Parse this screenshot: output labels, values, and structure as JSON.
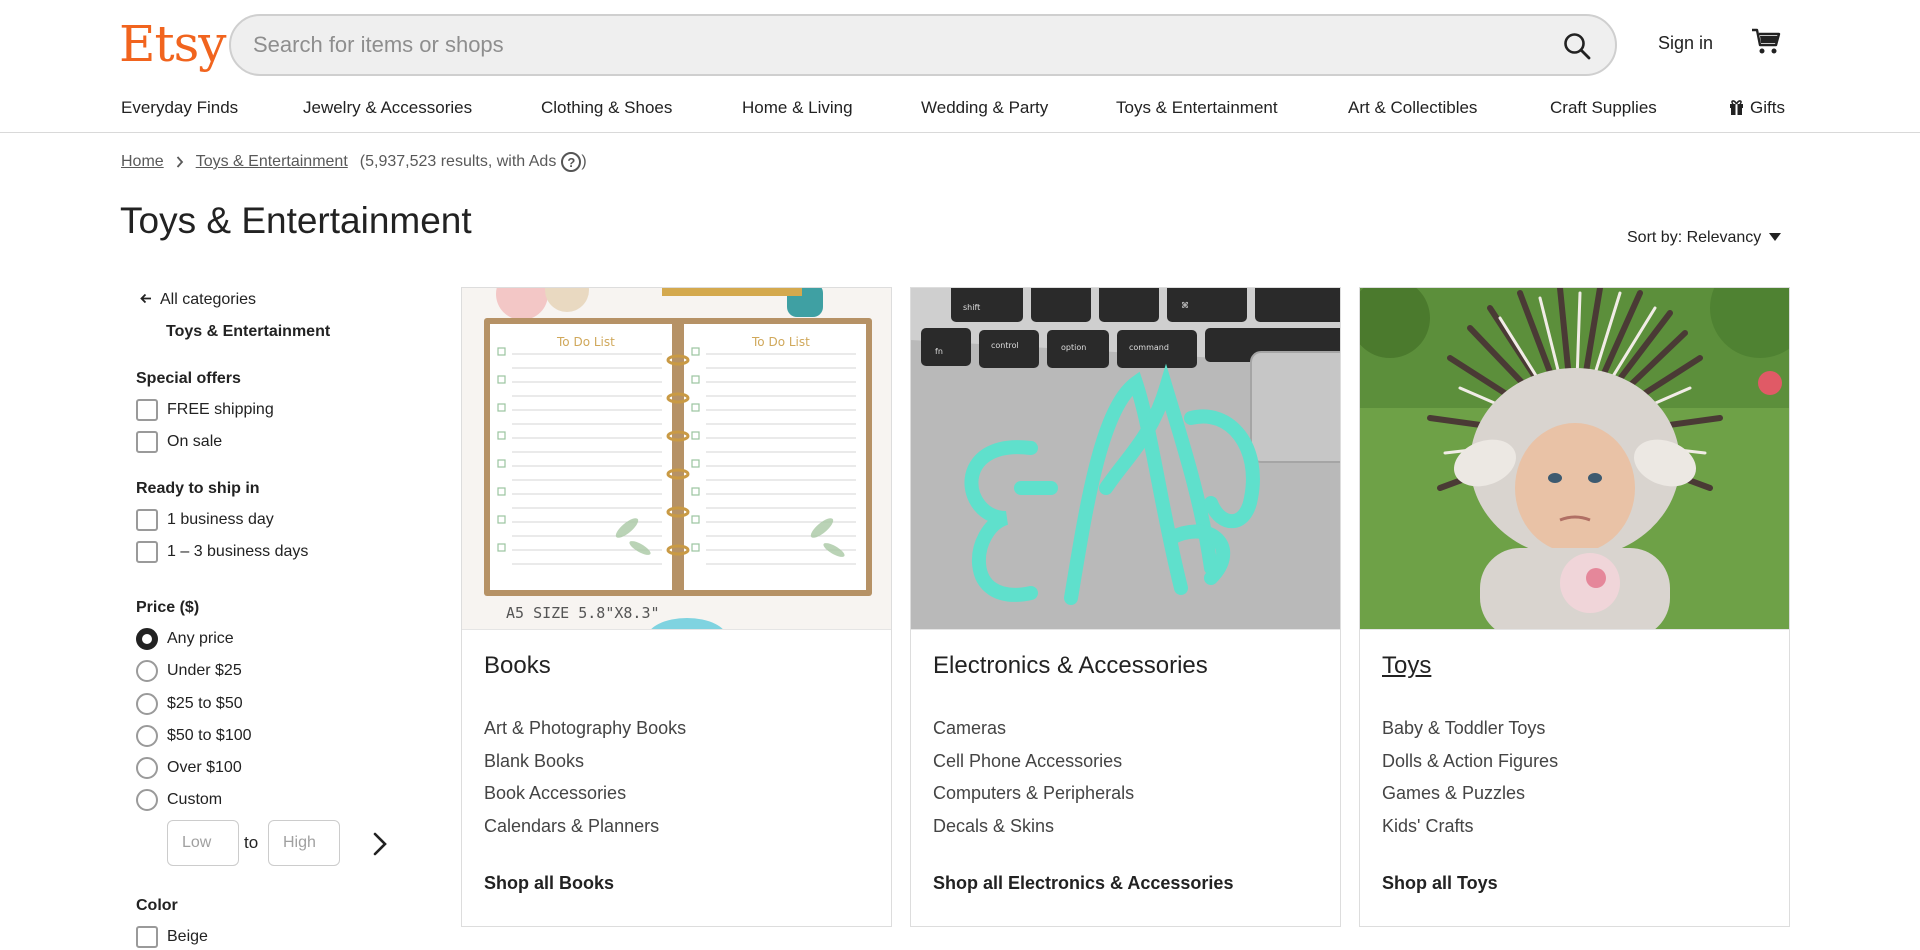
{
  "header": {
    "logo": "Etsy",
    "search_placeholder": "Search for items or shops",
    "search_value": "",
    "sign_in": "Sign in"
  },
  "nav": {
    "items": [
      "Everyday Finds",
      "Jewelry & Accessories",
      "Clothing & Shoes",
      "Home & Living",
      "Wedding & Party",
      "Toys & Entertainment",
      "Art & Collectibles",
      "Craft Supplies",
      "Gifts"
    ]
  },
  "breadcrumb": {
    "home": "Home",
    "current": "Toys & Entertainment",
    "results": "(5,937,523 results, with Ads",
    "help_symbol": "?",
    "close_paren": ")"
  },
  "page": {
    "title": "Toys & Entertainment",
    "sort_label": "Sort by: Relevancy"
  },
  "sidebar": {
    "all_categories": "All categories",
    "current_category": "Toys & Entertainment",
    "special_offers": {
      "heading": "Special offers",
      "options": [
        "FREE shipping",
        "On sale"
      ]
    },
    "ready_to_ship": {
      "heading": "Ready to ship in",
      "options": [
        "1 business day",
        "1 – 3 business days"
      ]
    },
    "price": {
      "heading": "Price ($)",
      "options": [
        "Any price",
        "Under $25",
        "$25 to $50",
        "$50 to $100",
        "Over $100",
        "Custom"
      ],
      "selected": "Any price",
      "low_placeholder": "Low",
      "high_placeholder": "High",
      "to": "to"
    },
    "color": {
      "heading": "Color",
      "options": [
        "Beige"
      ]
    }
  },
  "cards": [
    {
      "title": "Books",
      "links": [
        "Art & Photography Books",
        "Blank Books",
        "Book Accessories",
        "Calendars & Planners"
      ],
      "shop_all": "Shop all Books",
      "image_text": {
        "page_left": "To Do List",
        "page_right": "To Do List",
        "size": "A5 SIZE   5.8\"X8.3\""
      }
    },
    {
      "title": "Electronics & Accessories",
      "links": [
        "Cameras",
        "Cell Phone Accessories",
        "Computers & Peripherals",
        "Decals & Skins"
      ],
      "shop_all": "Shop all Electronics & Accessories",
      "image_text": {
        "keys": [
          "shift",
          "control",
          "option",
          "command",
          "fn",
          "⌘"
        ]
      }
    },
    {
      "title": "Toys",
      "links": [
        "Baby & Toddler Toys",
        "Dolls & Action Figures",
        "Games & Puzzles",
        "Kids' Crafts"
      ],
      "shop_all": "Shop all Toys"
    }
  ],
  "colors": {
    "brand": "#f1641e",
    "text": "#222222",
    "border": "#dddddd",
    "decal": "#5fe0cc"
  }
}
